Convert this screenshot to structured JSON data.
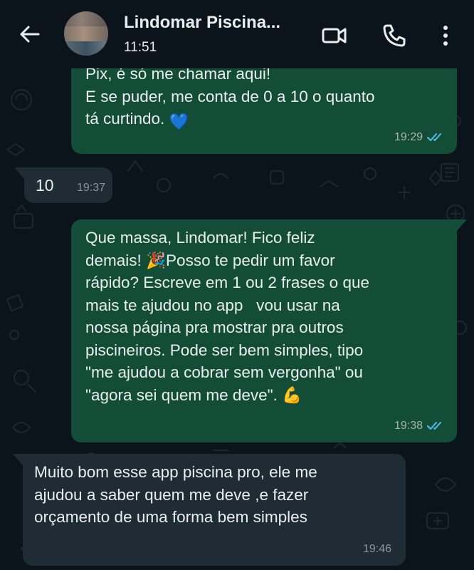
{
  "header": {
    "contact_name": "Lindomar Piscina...",
    "status_time": "11:51",
    "icons": [
      "back-arrow-icon",
      "video-call-icon",
      "phone-call-icon",
      "more-options-icon"
    ]
  },
  "messages": [
    {
      "direction": "outgoing",
      "text_lines": [
        "Pix, é só me chamar aqui!",
        "E se puder, me conta de 0 a 10 o quanto",
        "tá curtindo."
      ],
      "emoji": "💙",
      "time": "19:29",
      "status": "read"
    },
    {
      "direction": "incoming",
      "text": "10",
      "time": "19:37"
    },
    {
      "direction": "outgoing",
      "text_lines": [
        "Que massa, Lindomar! Fico feliz",
        "demais! 🎉Posso te pedir um favor",
        "rápido? Escreve em 1 ou 2 frases o que",
        "mais te ajudou no app   vou usar na",
        "nossa página pra mostrar pra outros",
        "piscineiros. Pode ser bem simples, tipo",
        "\"me ajudou a cobrar sem vergonha\" ou",
        "\"agora sei quem me deve\". 💪"
      ],
      "time": "19:38",
      "status": "read"
    },
    {
      "direction": "incoming",
      "text_lines": [
        "Muito bom esse app piscina pro, ele me",
        "ajudou a saber quem me deve ,e fazer",
        "orçamento de uma forma bem simples"
      ],
      "time": "19:46"
    }
  ],
  "colors": {
    "background": "#0b141a",
    "outgoing_bubble": "#144d37",
    "incoming_bubble": "#202c33",
    "read_ticks": "#53bdeb"
  }
}
